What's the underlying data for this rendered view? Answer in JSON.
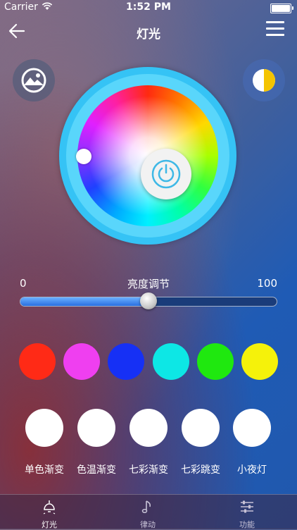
{
  "status": {
    "carrier": "Carrier",
    "time": "1:52 PM"
  },
  "nav": {
    "title": "灯光"
  },
  "brightness": {
    "min": "0",
    "title": "亮度调节",
    "max": "100",
    "level_percent": 50
  },
  "swatches": [
    "#ff2a16",
    "#ef3ff0",
    "#1630f5",
    "#0de7e5",
    "#1fe80f",
    "#f5f20a"
  ],
  "modes": [
    {
      "label": "单色渐变"
    },
    {
      "label": "色温渐变"
    },
    {
      "label": "七彩渐变"
    },
    {
      "label": "七彩跳变"
    },
    {
      "label": "小夜灯"
    }
  ],
  "tabs": [
    {
      "label": "灯光",
      "icon": "lamp-icon",
      "active": true
    },
    {
      "label": "律动",
      "icon": "music-note-icon",
      "active": false
    },
    {
      "label": "功能",
      "icon": "sliders-icon",
      "active": false
    }
  ]
}
